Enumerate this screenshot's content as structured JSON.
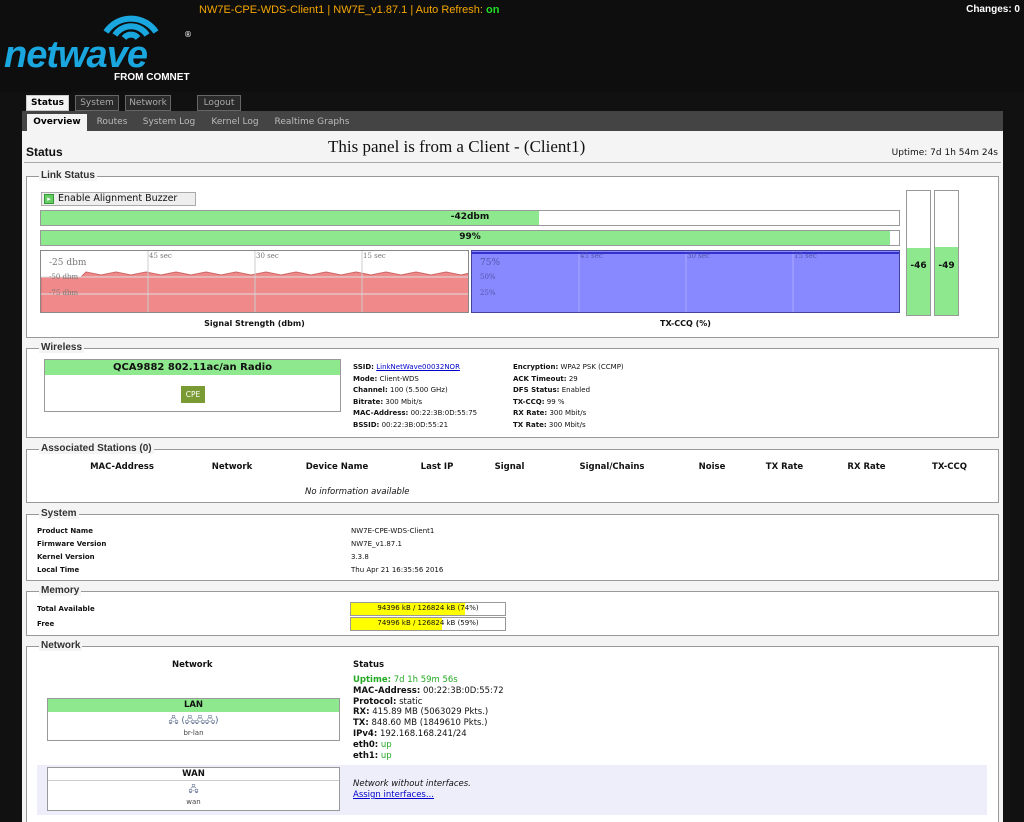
{
  "header": {
    "brand": "netwave",
    "reg": "®",
    "sub": "FROM COMNET",
    "device": "NW7E-CPE-WDS-Client1",
    "sep1": " | ",
    "firmware": "NW7E_v1.87.1",
    "sep2": " | ",
    "auto_refresh_label": "Auto Refresh: ",
    "auto_refresh_value": "on",
    "changes": "Changes: 0",
    "accent": "#1aa7df"
  },
  "tabs": {
    "top": [
      "Status",
      "System",
      "Network",
      "Logout"
    ],
    "sub": [
      "Overview",
      "Routes",
      "System Log",
      "Kernel Log",
      "Realtime Graphs"
    ]
  },
  "panel": {
    "title": "Status",
    "message": "This panel is from a Client - (Client1)",
    "uptime": "Uptime: 7d 1h 54m 24s"
  },
  "link_status": {
    "legend": "Link Status",
    "buzzer": "Enable Alignment Buzzer",
    "signal_label": "-42dbm",
    "signal_fraction": 0.58,
    "ccq_label": "99%",
    "ccq_fraction": 0.99,
    "signal_graph": {
      "title": "Signal Strength (dbm)",
      "ticks": [
        "45 sec",
        "30 sec",
        "15 sec"
      ],
      "ylabels": [
        "-25 dbm",
        "-50 dbm",
        "-75 dbm"
      ]
    },
    "ccq_graph": {
      "title": "TX-CCQ (%)",
      "ticks": [
        "45 sec",
        "30 sec",
        "15 sec"
      ],
      "ylabels": [
        "75%",
        "50%",
        "25%"
      ]
    },
    "chain1": {
      "label": "-46",
      "fraction": 0.54
    },
    "chain2": {
      "label": "-49",
      "fraction": 0.55
    }
  },
  "wireless": {
    "legend": "Wireless",
    "radio": "QCA9882 802.11ac/an Radio",
    "mode_badge": "CPE",
    "left": [
      {
        "k": "SSID:",
        "v": "LinkNetWave00032NOR",
        "link": true
      },
      {
        "k": "Mode:",
        "v": "Client-WDS"
      },
      {
        "k": "Channel:",
        "v": "100 (5.500 GHz)"
      },
      {
        "k": "Bitrate:",
        "v": "300 Mbit/s"
      },
      {
        "k": "MAC-Address:",
        "v": "00:22:3B:0D:55:75"
      },
      {
        "k": "BSSID:",
        "v": "00:22:3B:0D:55:21"
      }
    ],
    "right": [
      {
        "k": "Encryption:",
        "v": "WPA2 PSK (CCMP)"
      },
      {
        "k": "ACK Timeout:",
        "v": "29"
      },
      {
        "k": "DFS Status:",
        "v": "Enabled"
      },
      {
        "k": "TX-CCQ:",
        "v": "99 %"
      },
      {
        "k": "RX Rate:",
        "v": "300 Mbit/s"
      },
      {
        "k": "TX Rate:",
        "v": "300 Mbit/s"
      }
    ]
  },
  "stations": {
    "legend": "Associated Stations (0)",
    "columns": [
      "MAC-Address",
      "Network",
      "Device Name",
      "Last IP",
      "Signal",
      "Signal/Chains",
      "Noise",
      "TX Rate",
      "RX Rate",
      "TX-CCQ"
    ],
    "empty": "No information available"
  },
  "system": {
    "legend": "System",
    "rows": [
      {
        "k": "Product Name",
        "v": "NW7E-CPE-WDS-Client1"
      },
      {
        "k": "Firmware Version",
        "v": "NW7E_v1.87.1"
      },
      {
        "k": "Kernel Version",
        "v": "3.3.8"
      },
      {
        "k": "Local Time",
        "v": "Thu Apr 21 16:35:56 2016"
      }
    ]
  },
  "memory": {
    "legend": "Memory",
    "rows": [
      {
        "k": "Total Available",
        "v": "94396 kB / 126824 kB (74%)",
        "fraction": 0.74
      },
      {
        "k": "Free",
        "v": "74996 kB / 126824 kB (59%)",
        "fraction": 0.59
      }
    ]
  },
  "network": {
    "legend": "Network",
    "col_network": "Network",
    "col_status": "Status",
    "lan": {
      "name": "LAN",
      "icons": "🖧 (🖧🖧🖧)",
      "device": "br-lan",
      "status": [
        {
          "k": "Uptime:",
          "v": "7d 1h 59m 56s",
          "green": true
        },
        {
          "k": "MAC-Address:",
          "v": "00:22:3B:0D:55:72"
        },
        {
          "k": "Protocol:",
          "v": "static"
        },
        {
          "k": "RX:",
          "v": "415.89 MB (5063029 Pkts.)"
        },
        {
          "k": "TX:",
          "v": "848.60 MB (1849610 Pkts.)"
        },
        {
          "k": "IPv4:",
          "v": "192.168.168.241/24"
        },
        {
          "k": "eth0:",
          "v": "up",
          "green": true
        },
        {
          "k": "eth1:",
          "v": "up",
          "green": true
        }
      ]
    },
    "wan": {
      "name": "WAN",
      "icons": "🖧",
      "device": "wan",
      "status_text": "Network without interfaces.",
      "assign_link": "Assign interfaces..."
    }
  }
}
